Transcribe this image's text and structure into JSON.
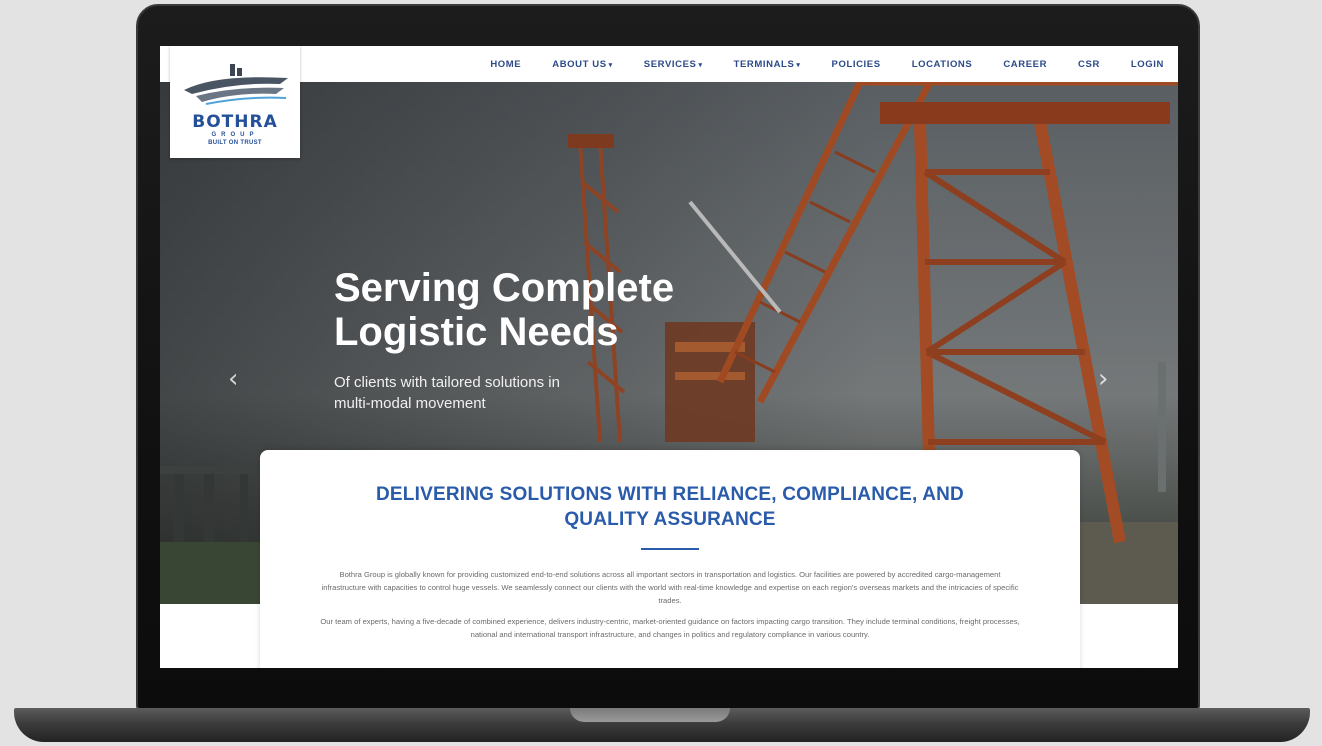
{
  "brand": {
    "name": "BOTHRA",
    "group": "GROUP",
    "tagline": "BUILT ON TRUST"
  },
  "nav": {
    "items": [
      {
        "label": "HOME",
        "dropdown": false
      },
      {
        "label": "ABOUT US",
        "dropdown": true
      },
      {
        "label": "SERVICES",
        "dropdown": true
      },
      {
        "label": "TERMINALS",
        "dropdown": true
      },
      {
        "label": "POLICIES",
        "dropdown": false
      },
      {
        "label": "LOCATIONS",
        "dropdown": false
      },
      {
        "label": "CAREER",
        "dropdown": false
      },
      {
        "label": "CSR",
        "dropdown": false
      },
      {
        "label": "LOGIN",
        "dropdown": false
      }
    ]
  },
  "hero": {
    "title_line1": "Serving Complete",
    "title_line2": "Logistic Needs",
    "subtitle_line1": "Of clients with tailored solutions in",
    "subtitle_line2": "multi-modal movement",
    "prev_icon": "‹",
    "next_icon": "›"
  },
  "content": {
    "heading_line1": "DELIVERING SOLUTIONS WITH RELIANCE, COMPLIANCE, AND",
    "heading_line2": "QUALITY ASSURANCE",
    "paragraph1": "Bothra Group is globally known for providing customized end-to-end solutions across all important sectors in transportation and logistics. Our facilities are powered by accredited cargo-management infrastructure with capacities to control huge vessels. We seamlessly connect our clients with the world with real-time knowledge and expertise on each region's overseas markets and the intricacies of specific trades.",
    "paragraph2": "Our team of experts, having a five-decade of combined experience, delivers industry-centric, market-oriented guidance on factors impacting cargo transition. They include terminal conditions, freight processes, national and international transport infrastructure, and changes in politics and regulatory compliance in various country."
  },
  "colors": {
    "accent": "#2a5bab",
    "nav_text": "#2c4a8a",
    "crane": "#9a4a26"
  }
}
